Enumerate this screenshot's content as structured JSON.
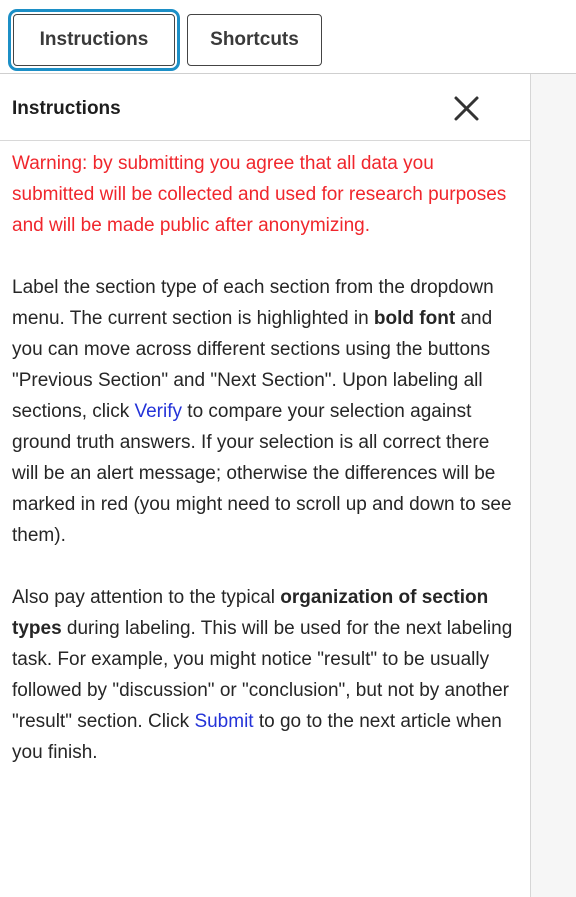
{
  "tabs": {
    "instructions_label": "Instructions",
    "shortcuts_label": "Shortcuts"
  },
  "panel": {
    "title": "Instructions",
    "close_icon": "close-icon",
    "warning": "Warning: by submitting you agree that all data you submitted will be collected and used for research purposes and will be made public after anonymizing.",
    "para1": {
      "t1": "Label the section type of each section from the dropdown menu. The current section is highlighted in ",
      "bold": "bold font",
      "t2": " and you can move across different sections using the buttons \"Previous Section\" and \"Next Section\". Upon labeling all sections, click ",
      "verify_link": "Verify",
      "t3": " to compare your selection against ground truth answers. If your selection is all correct there will be an alert message; otherwise the differences will be marked in red (you might need to scroll up and down to see them)."
    },
    "para2": {
      "t1": "Also pay attention to the typical ",
      "bold": "organization of section types",
      "t2": " during labeling. This will be used for the next labeling task. For example, you might notice \"result\" to be usually followed by \"discussion\" or \"conclusion\", but not by another \"result\" section. Click ",
      "submit_link": "Submit",
      "t3": " to go to the next article when you finish."
    }
  },
  "colors": {
    "warning": "#f0262c",
    "link": "#2433d8",
    "active_tab_outline": "#1c8fc6"
  }
}
